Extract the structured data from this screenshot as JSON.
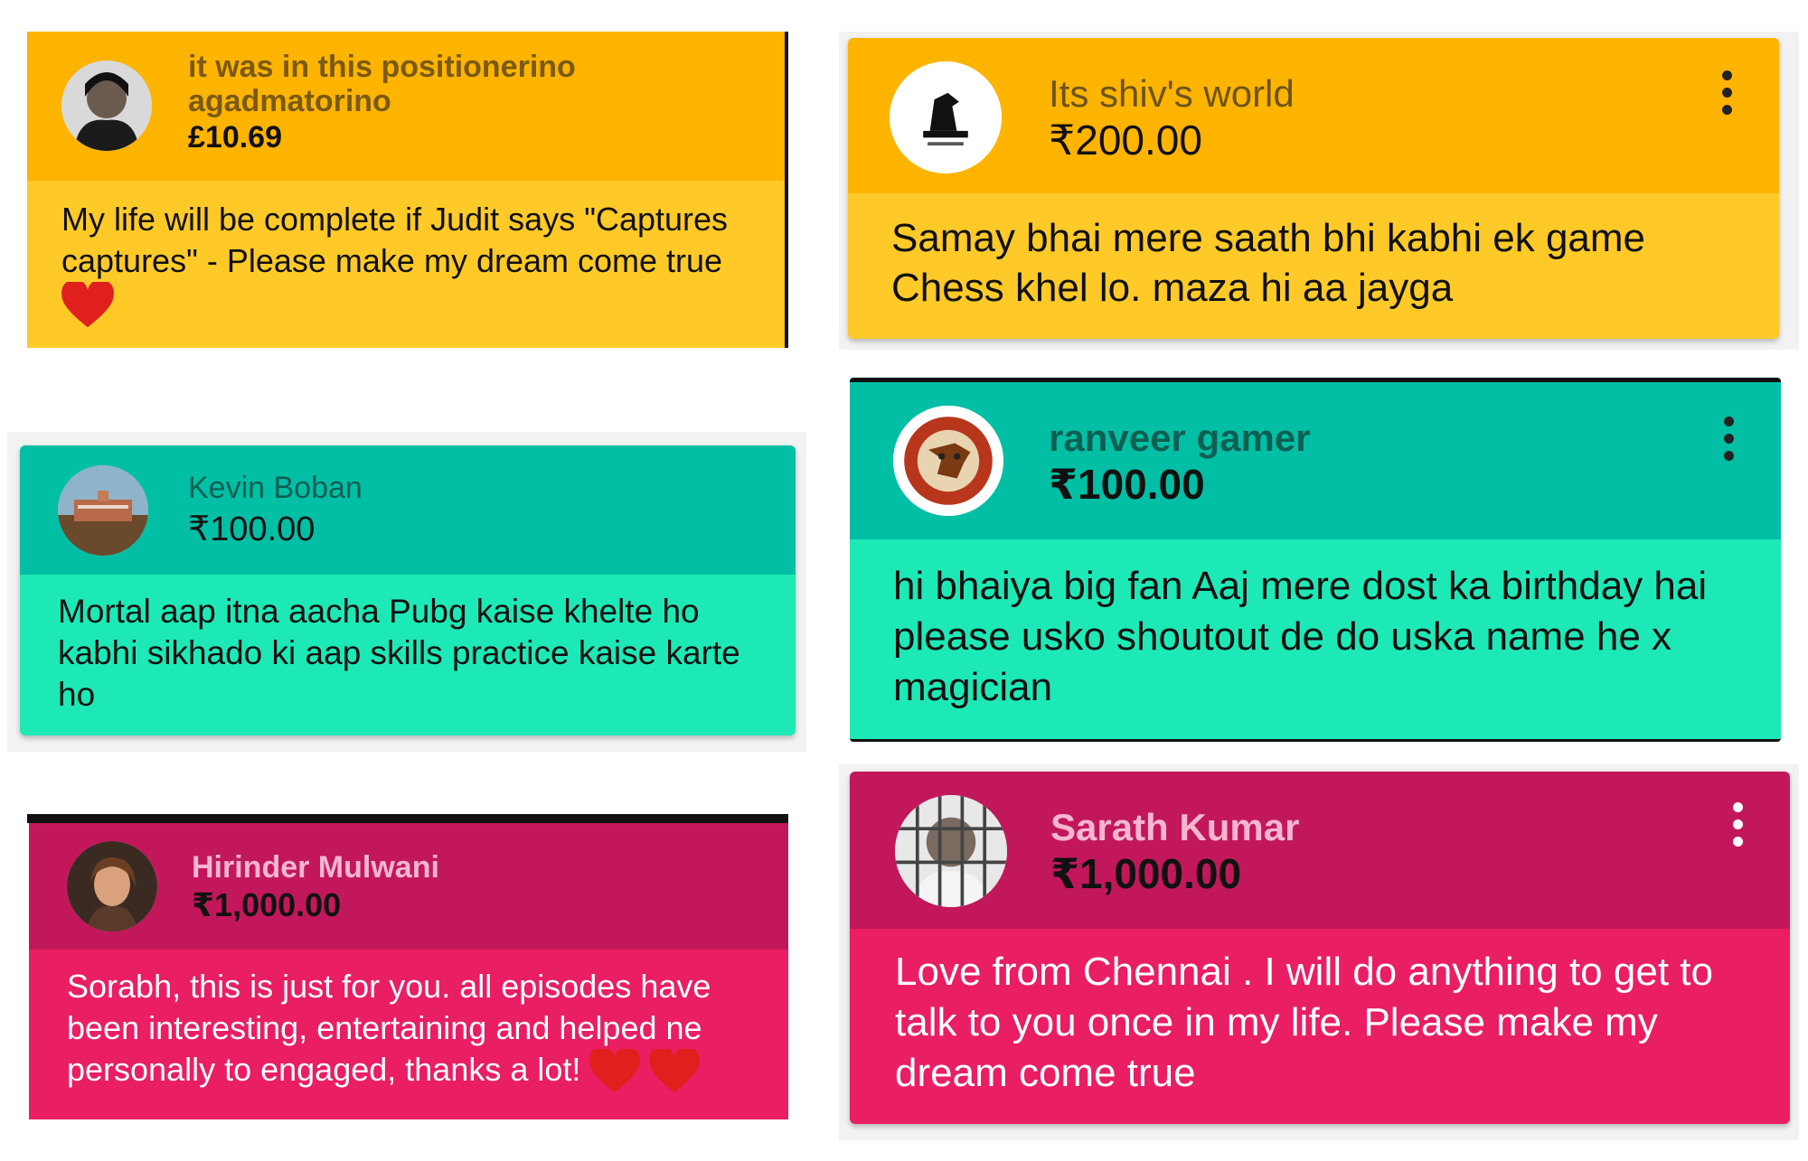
{
  "cards": [
    {
      "name_line1": "it was in this positionerino",
      "name_line2": "agadmatorino",
      "amount": "£10.69",
      "message": "My life will be complete if Judit says \"Captures captures\" - Please make my dream come true",
      "emoji": "heart",
      "header_color": "#ffb400",
      "body_color": "#ffca28"
    },
    {
      "name": "Its shiv's world",
      "amount": "₹200.00",
      "message": "Samay bhai mere saath bhi kabhi ek game Chess khel lo. maza hi aa jayga",
      "header_color": "#ffb400",
      "body_color": "#ffca28"
    },
    {
      "name": "Kevin Boban",
      "amount": "₹100.00",
      "message": "Mortal aap itna aacha Pubg kaise khelte ho kabhi sikhado ki aap skills practice kaise karte ho",
      "header_color": "#00bfa5",
      "body_color": "#1de9b6"
    },
    {
      "name": "ranveer gamer",
      "amount": "₹100.00",
      "message": "hi bhaiya big fan Aaj mere dost ka birthday hai please usko shoutout de do uska name he x magician",
      "header_color": "#00bfa5",
      "body_color": "#1de9b6"
    },
    {
      "name": "Hirinder Mulwani",
      "amount": "₹1,000.00",
      "message": "Sorabh, this is just for you. all episodes have been interesting, entertaining and helped ne personally to engaged, thanks a lot!",
      "emoji": "heart heart",
      "header_color": "#c2185b",
      "body_color": "#e91e63"
    },
    {
      "name": "Sarath Kumar",
      "amount": "₹1,000.00",
      "message": "Love from Chennai . I will do anything to get to talk to you once in my life. Please make my dream come true",
      "header_color": "#c2185b",
      "body_color": "#e91e63"
    }
  ]
}
